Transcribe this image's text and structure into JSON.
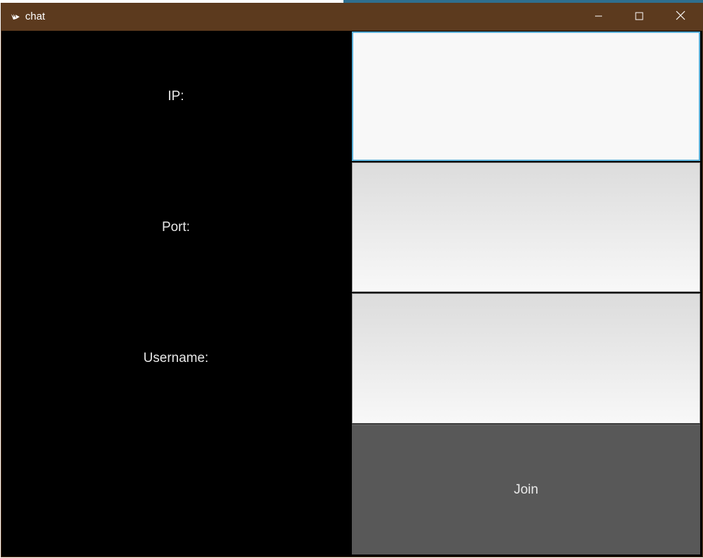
{
  "window": {
    "title": "chat",
    "icon": "kivy-logo-icon",
    "controls": {
      "minimize_icon": "minimize-icon",
      "maximize_icon": "maximize-icon",
      "close_icon": "close-icon"
    },
    "colors": {
      "titlebar": "#5c3a1e",
      "content_bg": "#000000",
      "button_bg": "#585858",
      "focus_border": "#5ab0d8"
    }
  },
  "form": {
    "ip_label": "IP:",
    "port_label": "Port:",
    "username_label": "Username:",
    "ip_value": "",
    "port_value": "",
    "username_value": "",
    "join_label": "Join"
  }
}
